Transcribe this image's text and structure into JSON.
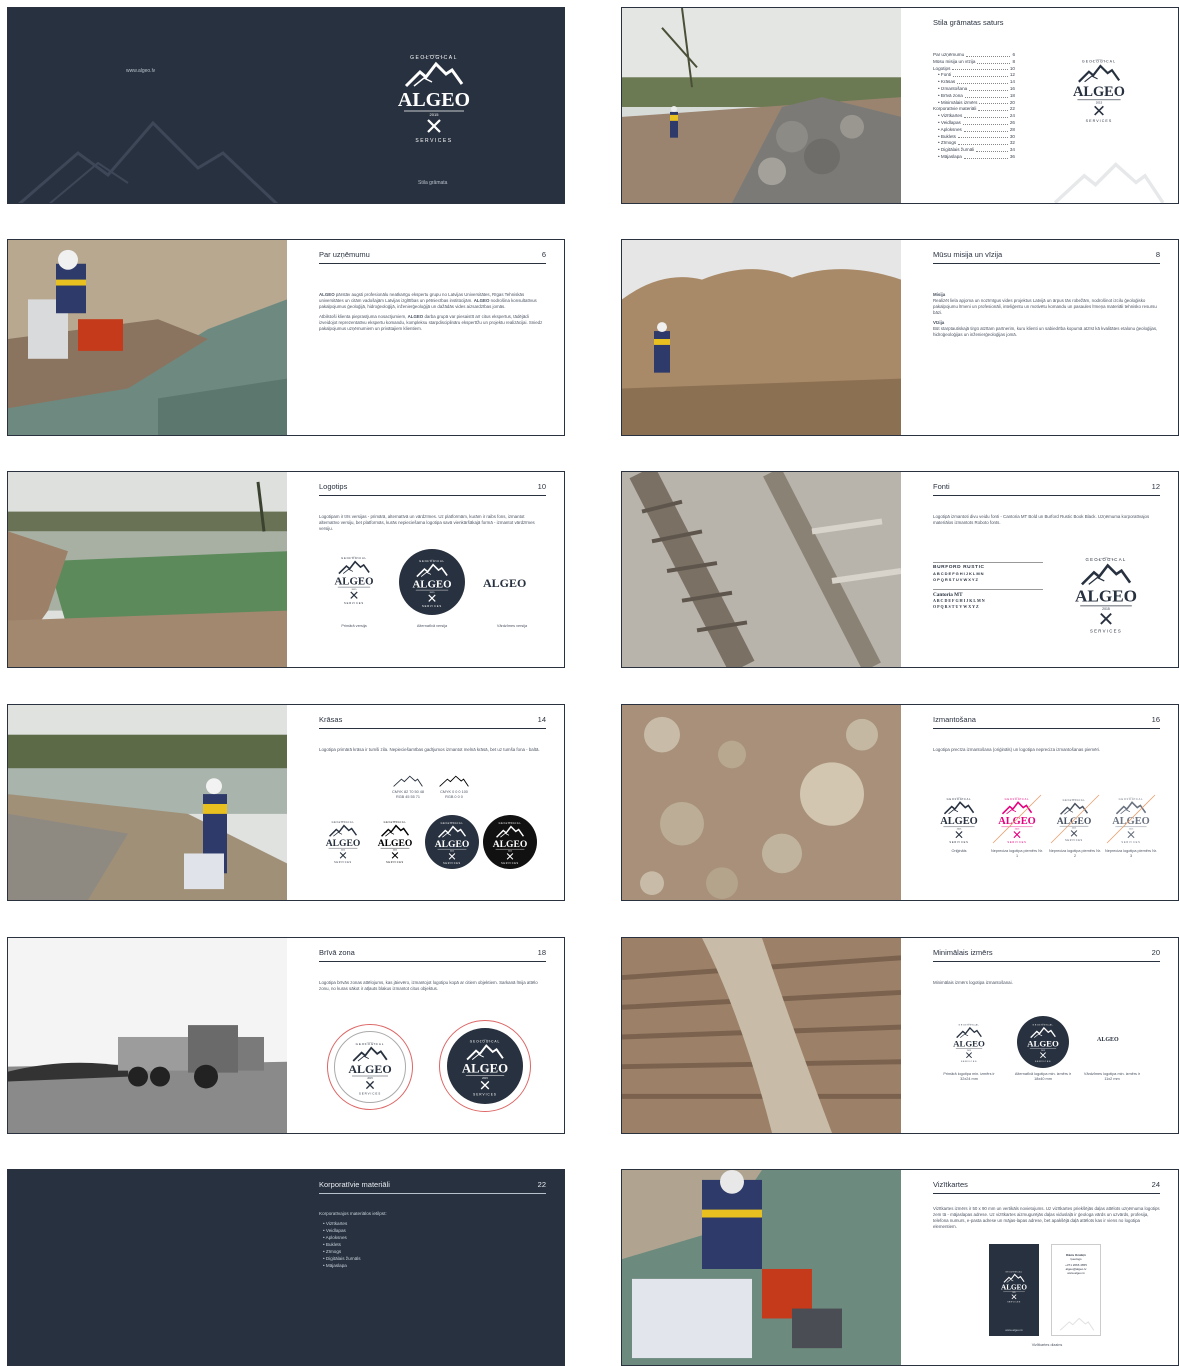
{
  "colors": {
    "navy": "#28313f",
    "magenta": "#e6007e",
    "light": "#ffffff"
  },
  "cover": {
    "url": "www.algeo.lv",
    "subtitle": "Stila grāmata",
    "brand_top": "GEOLOGICAL",
    "brand": "ALGEO",
    "year": "2015",
    "brand_bottom": "SERVICES"
  },
  "toc": {
    "title": "Stila grāmatas saturs",
    "items": [
      {
        "label": "Par uzņēmumu",
        "page": "6"
      },
      {
        "label": "Mūsu misija un vīzija",
        "page": "8"
      },
      {
        "label": "Logotips",
        "page": "10"
      },
      {
        "label": "• Fonti",
        "page": "12"
      },
      {
        "label": "• Krāsas",
        "page": "14"
      },
      {
        "label": "• Izmantošana",
        "page": "16"
      },
      {
        "label": "• Brīvā zona",
        "page": "18"
      },
      {
        "label": "• Minimālais izmērs",
        "page": "20"
      },
      {
        "label": "Korporatīvie materiāli",
        "page": "22"
      },
      {
        "label": "• Vizītkartes",
        "page": "24"
      },
      {
        "label": "• Veidlapas",
        "page": "26"
      },
      {
        "label": "• Aploksnes",
        "page": "28"
      },
      {
        "label": "• Buklets",
        "page": "30"
      },
      {
        "label": "• Zīmogs",
        "page": "32"
      },
      {
        "label": "• Digitālais žurnāli",
        "page": "34"
      },
      {
        "label": "• Mājaslapa",
        "page": "36"
      }
    ]
  },
  "about": {
    "title": "Par uzņēmumu",
    "page": "6",
    "p1_bold": "ALGEO",
    "p1": "pārstāv augsti profesionālu neatkarīgu ekspertu grupu no Latvijas Universitātes, Rīgas Tehniskās universitātes un citām vadošajām Latvijas izglītības un pētniecības institūcijām.",
    "p1b_bold": "ALGEO",
    "p1b": "nodrošina konsultatīvus pakalpojumus ģeoloģijā, hidroģeoloģijā, inženierģeoloģijā un dažādās vides aizsardzības jomās.",
    "p2a": "Atbilstoši klienta pieprasījuma nosacījumiem,",
    "p2_bold": "ALGEO",
    "p2b": "darba grupā var piesaistīt arī citus ekspertus, tādējādi izveidojot reprezentatīvu ekspertu komandu, kompleksu starpdisciplināru ekspertīžu un projektu realizācijai. Sniedz pakalpojumus uzņēmumiem un privātajiem klientiem."
  },
  "mission": {
    "title": "Mūsu misija un vīzija",
    "page": "8",
    "h1": "Misija",
    "t1": "Realizēt liela apjoma un nozīmīgus vides projektus Latvijā un ārpus tās robežām, nodrošinot izcilu ģeoloģisko pakalpojumu līmeni un profesionāli, inteliģentu un motivētu komandu un pasaules līmeņa materiāli tehnisko resursu bāzi.",
    "h2": "Vīzija",
    "t2": "Būt starptautiskajā tirgū atzītam partnerim, kuru klienti un sabiedrība kopumā atzīst kā kvalitātes etalonu ģeoloģijas, hidroģeoloģijas un inženierģeoloģijas jomā."
  },
  "logo": {
    "title": "Logotips",
    "page": "10",
    "text": "Logotipam ir trīs versijas - primārā, alternatīvā un vārdzīmes. Uz platformām, kurām ir raibs fons, izmantot alternatīvo versiju, bet platformās, kurās nepieciešama logotipa savā vienkāršākajā formā - izmantot vārdzīmes versiju.",
    "labels": [
      "Primārā versija",
      "Alternatīvā versija",
      "Vārdzīmes versija"
    ]
  },
  "fonts": {
    "title": "Fonti",
    "page": "12",
    "text": "Logotipā izmantoti divu veidu fonti - Cantoria MT Bold un Burford Rustic Book Black. Uzņēmuma korporatīvajos materiālos izmantots Roboto fonts.",
    "f1": "BURFORD RUSTIC",
    "f1a": "ABCDEFGHIJKLMN",
    "f1b": "OPQRSTUVWXYZ",
    "f2": "Cantoria MT",
    "f2a": "ABCDEFGHIJKLMN",
    "f2b": "OPQRSTUVWXYZ"
  },
  "colours": {
    "title": "Krāsas",
    "page": "14",
    "text": "Logotipa primārā krāsa ir tumši zila. Nepieciešamības gadījumos izmantot melnā krāsā, bet uz tumša fona - baltā.",
    "c1a": "CMYK 82 70 50 48",
    "c1b": "RGB 45 55 71",
    "c2a": "CMYK 0 0 0 100",
    "c2b": "RGB 0 0 0"
  },
  "usage": {
    "title": "Izmantošana",
    "page": "16",
    "text": "Logotipa precīza izmantošana (oriģināls) un logotipa nepreciza izmantošanas piemēri.",
    "labels": [
      "Oriģināls",
      "Nepreciza logotipa piemērs Nr. 1",
      "Nepreciza logotipa piemērs Nr. 2",
      "Nepreciza logotipa piemērs Nr. 3"
    ]
  },
  "clear": {
    "title": "Brīvā zona",
    "page": "18",
    "text": "Logotipa brīvās zonas attēlojums, kas jāievēro, izmantojot logotipu kopā ar citiem objektiem. Sarkanā līnija attēlo zonu, no kuras sākot ir atļauts blakus izmantot citus objektus."
  },
  "minsize": {
    "title": "Minimālais izmērs",
    "page": "20",
    "text": "Minimālais izmērs logotipa izmantošanai.",
    "labels": [
      "Primārā logotipa min. izmērs ir 32x24 mm",
      "Alternatīvā logotipa min. izmērs ir 18x40 mm",
      "Vārdzīmes logotipa min. izmērs ir 11x2 mm"
    ]
  },
  "corporate": {
    "title": "Korporatīvie materiāli",
    "page": "22",
    "intro": "Korporatīvajos materiālos ietilpst:",
    "items": [
      "• Vizītkartes",
      "• Veidlapas",
      "• Aploksnes",
      "• Buklets",
      "• Zīmogs",
      "• Digitālais žurnāls",
      "• Mājaslapa"
    ]
  },
  "cards": {
    "title": "Vizītkartes",
    "page": "24",
    "text": "Vizītkartes izmērs ir 50 x 90 mm un vertikāls novietojums. Uz vizītkartes priekšējās daļas attēlots uzņēmuma logotips zem tā - mājaslapas adrese. Uz vizītkartes aizmugurējās daļas viduslaļā ir ģeologa vārds un uzvārds, profesija, telefona numurs, e-pasta adrese un mājas-lapas adrese, bet apakšējā daļā attēlots kas ir viens no logotipa elementiem.",
    "name": "Dāvis Ozoliņš",
    "role": "Ģeologs",
    "phone": "+371 2666 4655",
    "email": "algeo@algeo.lv",
    "web": "www.algeo.lv",
    "caption": "Vizītkartes dizains"
  }
}
